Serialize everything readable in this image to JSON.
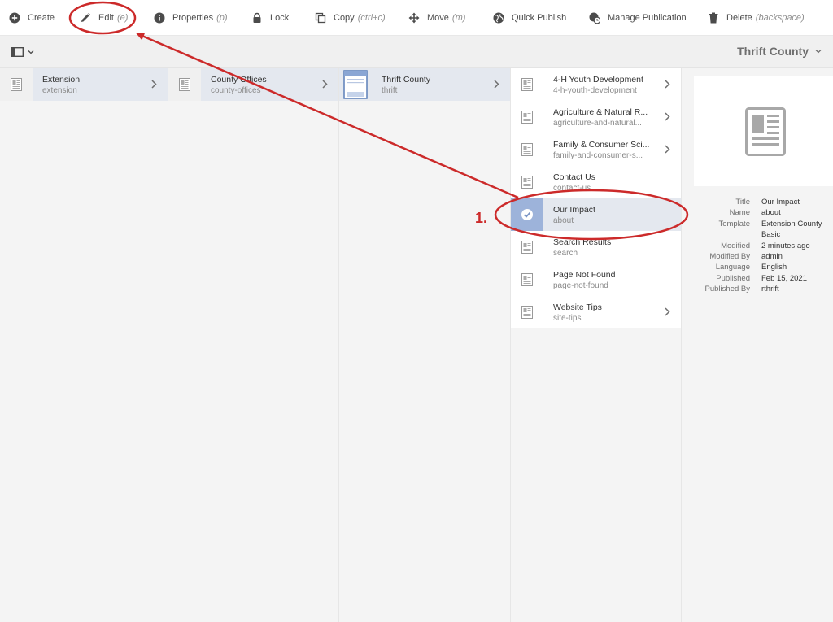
{
  "toolbar": {
    "create": "Create",
    "edit": "Edit",
    "edit_shortcut": "(e)",
    "properties": "Properties",
    "properties_shortcut": "(p)",
    "lock": "Lock",
    "copy": "Copy",
    "copy_shortcut": "(ctrl+c)",
    "move": "Move",
    "move_shortcut": "(m)",
    "quick_publish": "Quick Publish",
    "manage_publication": "Manage Publication",
    "delete": "Delete",
    "delete_shortcut": "(backspace)"
  },
  "context_title": "Thrift County",
  "columns": [
    {
      "items": [
        {
          "title": "Extension",
          "name": "extension",
          "has_children": true,
          "active": true
        }
      ]
    },
    {
      "items": [
        {
          "title": "County Offices",
          "name": "county-offices",
          "has_children": true,
          "active": true
        }
      ]
    },
    {
      "items": [
        {
          "title": "Thrift County",
          "name": "thrift",
          "has_children": true,
          "active": true
        }
      ]
    },
    {
      "items": [
        {
          "title": "4-H Youth Development",
          "name": "4-h-youth-development",
          "has_children": true
        },
        {
          "title": "Agriculture & Natural R...",
          "name": "agriculture-and-natural...",
          "has_children": true
        },
        {
          "title": "Family & Consumer Sci...",
          "name": "family-and-consumer-s...",
          "has_children": true
        },
        {
          "title": "Contact Us",
          "name": "contact-us",
          "has_children": false
        },
        {
          "title": "Our Impact",
          "name": "about",
          "has_children": false,
          "selected": true
        },
        {
          "title": "Search Results",
          "name": "search",
          "has_children": false
        },
        {
          "title": "Page Not Found",
          "name": "page-not-found",
          "has_children": false
        },
        {
          "title": "Website Tips",
          "name": "site-tips",
          "has_children": true
        }
      ]
    }
  ],
  "preview": {
    "meta": [
      {
        "label": "Title",
        "value": "Our Impact"
      },
      {
        "label": "Name",
        "value": "about"
      },
      {
        "label": "Template",
        "value": "Extension County Basic"
      },
      {
        "label": "Modified",
        "value": "2 minutes ago"
      },
      {
        "label": "Modified By",
        "value": "admin"
      },
      {
        "label": "Language",
        "value": "English"
      },
      {
        "label": "Published",
        "value": "Feb 15, 2021"
      },
      {
        "label": "Published By",
        "value": "rthrift"
      }
    ]
  },
  "annotation": {
    "step_label": "1.",
    "color": "#cc2a2a"
  },
  "colors": {
    "selected_thumb": "#9db3da",
    "active_row": "#e4e8ef"
  }
}
